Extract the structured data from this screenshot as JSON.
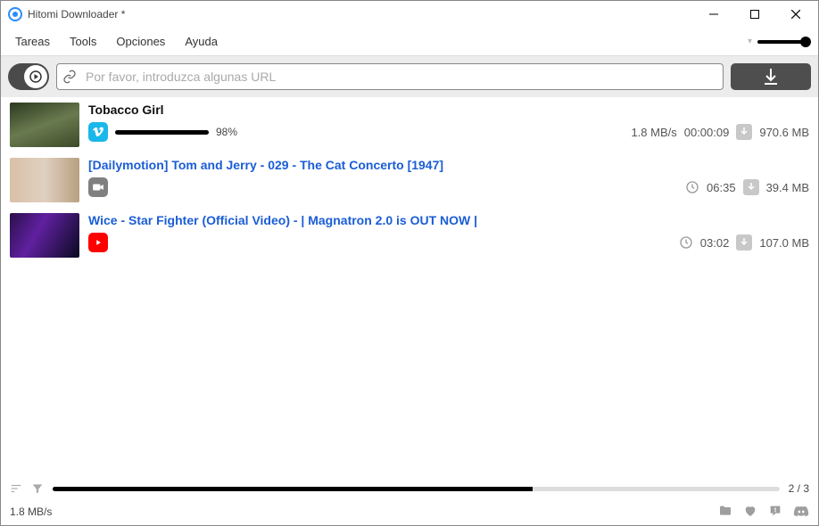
{
  "window": {
    "title": "Hitomi Downloader *"
  },
  "menu": {
    "tareas": "Tareas",
    "tools": "Tools",
    "opciones": "Opciones",
    "ayuda": "Ayuda"
  },
  "url_input": {
    "placeholder": "Por favor, introduzca algunas URL"
  },
  "downloads": [
    {
      "title": "Tobacco Girl",
      "source": "vimeo",
      "percent": "98%",
      "speed": "1.8 MB/s",
      "eta": "00:00:09",
      "size": "970.6 MB",
      "state": "downloading"
    },
    {
      "title": "[Dailymotion] Tom and Jerry - 029 - The Cat Concerto  [1947]",
      "source": "video",
      "duration": "06:35",
      "size": "39.4 MB",
      "state": "queued"
    },
    {
      "title": "Wice - Star Fighter (Official Video) - | Magnatron 2.0 is OUT NOW |",
      "source": "youtube",
      "duration": "03:02",
      "size": "107.0 MB",
      "state": "queued"
    }
  ],
  "footer": {
    "count": "2 / 3",
    "speed": "1.8 MB/s"
  }
}
